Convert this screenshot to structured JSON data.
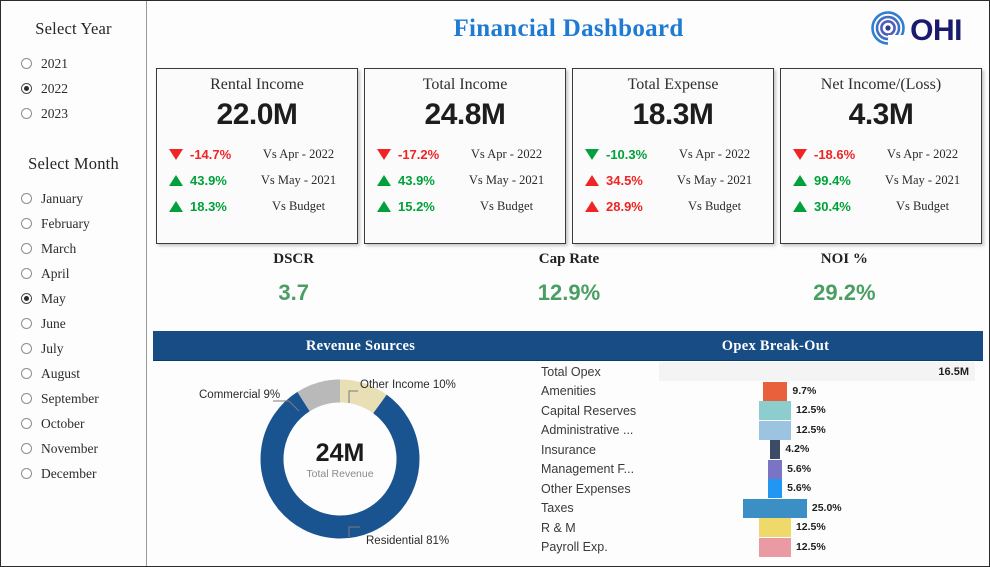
{
  "header": {
    "title": "Financial Dashboard",
    "logo_text": "OHI",
    "logo_icon": "spiral-target-icon",
    "title_color": "#1f7ad4",
    "logo_color": "#1b1b6e"
  },
  "sidebar": {
    "year_slicer": {
      "title": "Select Year",
      "selected": "2022",
      "options": [
        "2021",
        "2022",
        "2023"
      ]
    },
    "month_slicer": {
      "title": "Select Month",
      "selected": "May",
      "options": [
        "January",
        "February",
        "March",
        "April",
        "May",
        "June",
        "July",
        "August",
        "September",
        "October",
        "November",
        "December"
      ]
    }
  },
  "kpi_cards": [
    {
      "title": "Rental Income",
      "value": "22.0M",
      "rows": [
        {
          "arrow": "down",
          "direction_color": "#f02424",
          "pct": "-14.7%",
          "comparison": "Vs Apr - 2022"
        },
        {
          "arrow": "up",
          "direction_color": "#00a13a",
          "pct": "43.9%",
          "comparison": "Vs May - 2021"
        },
        {
          "arrow": "up",
          "direction_color": "#00a13a",
          "pct": "18.3%",
          "comparison": "Vs Budget"
        }
      ]
    },
    {
      "title": "Total Income",
      "value": "24.8M",
      "rows": [
        {
          "arrow": "down",
          "direction_color": "#f02424",
          "pct": "-17.2%",
          "comparison": "Vs Apr - 2022"
        },
        {
          "arrow": "up",
          "direction_color": "#00a13a",
          "pct": "43.9%",
          "comparison": "Vs May - 2021"
        },
        {
          "arrow": "up",
          "direction_color": "#00a13a",
          "pct": "15.2%",
          "comparison": "Vs Budget"
        }
      ]
    },
    {
      "title": "Total Expense",
      "value": "18.3M",
      "rows": [
        {
          "arrow": "down",
          "direction_color": "#00a13a",
          "pct": "-10.3%",
          "comparison": "Vs Apr - 2022"
        },
        {
          "arrow": "up",
          "direction_color": "#f02424",
          "pct": "34.5%",
          "comparison": "Vs May - 2021"
        },
        {
          "arrow": "up",
          "direction_color": "#f02424",
          "pct": "28.9%",
          "comparison": "Vs Budget"
        }
      ]
    },
    {
      "title": "Net Income/(Loss)",
      "value": "4.3M",
      "rows": [
        {
          "arrow": "down",
          "direction_color": "#f02424",
          "pct": "-18.6%",
          "comparison": "Vs Apr - 2022"
        },
        {
          "arrow": "up",
          "direction_color": "#00a13a",
          "pct": "99.4%",
          "comparison": "Vs May - 2021"
        },
        {
          "arrow": "up",
          "direction_color": "#00a13a",
          "pct": "30.4%",
          "comparison": "Vs Budget"
        }
      ]
    }
  ],
  "metrics": [
    {
      "label": "DSCR",
      "value": "3.7"
    },
    {
      "label": "Cap Rate",
      "value": "12.9%"
    },
    {
      "label": "NOI %",
      "value": "29.2%"
    }
  ],
  "panels": {
    "revenue_title": "Revenue Sources",
    "opex_title": "Opex Break-Out",
    "header_color": "#174d84"
  },
  "chart_data": [
    {
      "type": "pie",
      "title": "Revenue Sources",
      "center_value": "24M",
      "center_label": "Total Revenue",
      "legend_position": "callouts",
      "categories": [
        "Other Income",
        "Residential",
        "Commercial"
      ],
      "values": [
        10,
        81,
        9
      ],
      "labels": [
        "Other Income 10%",
        "Residential 81%",
        "Commercial 9%"
      ],
      "colors": [
        "#e8dfb4",
        "#1a5490",
        "#b9b9b9"
      ]
    },
    {
      "type": "bar",
      "title": "Opex Break-Out",
      "orientation": "horizontal-centered",
      "total_label": "Total Opex",
      "total_value": "16.5M",
      "categories": [
        "Amenities",
        "Capital Reserves",
        "Administrative ...",
        "Insurance",
        "Management F...",
        "Other Expenses",
        "Taxes",
        "R & M",
        "Payroll Exp."
      ],
      "values": [
        9.7,
        12.5,
        12.5,
        4.2,
        5.6,
        5.6,
        25.0,
        12.5,
        12.5
      ],
      "value_labels": [
        "9.7%",
        "12.5%",
        "12.5%",
        "4.2%",
        "5.6%",
        "5.6%",
        "25.0%",
        "12.5%",
        "12.5%"
      ],
      "colors": [
        "#e8613c",
        "#8ccdcd",
        "#9cc4e0",
        "#3c4b66",
        "#7b74c4",
        "#2196f3",
        "#3b8fc4",
        "#eed96a",
        "#ea9aa2"
      ]
    }
  ]
}
